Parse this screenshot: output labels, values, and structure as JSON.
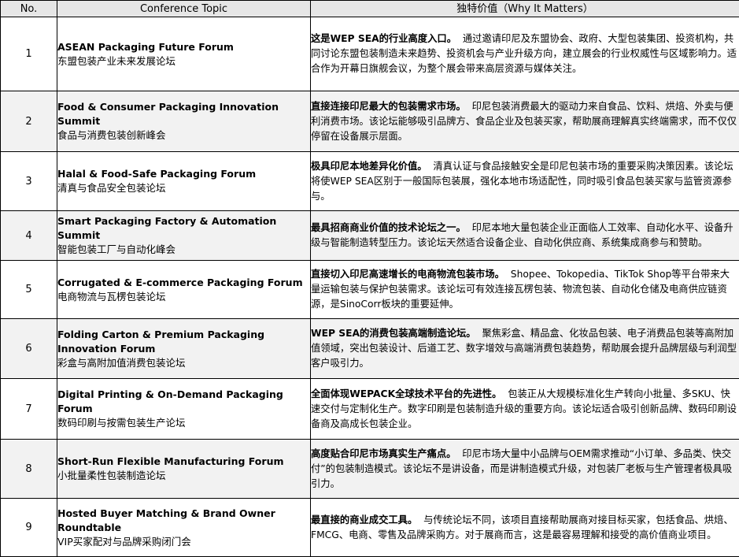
{
  "header": {
    "no": "No.",
    "topic": "Conference Topic",
    "why": "独特价值（Why It Matters）"
  },
  "rows": [
    {
      "no": "1",
      "topic_en": "ASEAN Packaging Future Forum",
      "topic_zh": "东盟包装产业未来发展论坛",
      "why_lead": "这是WEP SEA的行业高度入口。",
      "why_body": "通过邀请印尼及东盟协会、政府、大型包装集团、投资机构，共同讨论东盟包装制造未来趋势、投资机会与产业升级方向，建立展会的行业权威性与区域影响力。适合作为开幕日旗舰会议，为整个展会带来高层资源与媒体关注。"
    },
    {
      "no": "2",
      "topic_en": "Food & Consumer Packaging Innovation Summit",
      "topic_zh": "食品与消费包装创新峰会",
      "why_lead": "直接连接印尼最大的包装需求市场。",
      "why_body": "印尼包装消费最大的驱动力来自食品、饮料、烘焙、外卖与便利消费市场。该论坛能够吸引品牌方、食品企业及包装买家，帮助展商理解真实终端需求，而不仅仅停留在设备展示层面。"
    },
    {
      "no": "3",
      "topic_en": "Halal & Food-Safe Packaging Forum",
      "topic_zh": "清真与食品安全包装论坛",
      "why_lead": "极具印尼本地差异化价值。",
      "why_body": "清真认证与食品接触安全是印尼包装市场的重要采购决策因素。该论坛将使WEP SEA区别于一般国际包装展，强化本地市场适配性，同时吸引食品包装买家与监管资源参与。"
    },
    {
      "no": "4",
      "topic_en": "Smart Packaging Factory & Automation Summit",
      "topic_zh": "智能包装工厂与自动化峰会",
      "why_lead": "最具招商商业价值的技术论坛之一。",
      "why_body": "印尼本地大量包装企业正面临人工效率、自动化水平、设备升级与智能制造转型压力。该论坛天然适合设备企业、自动化供应商、系统集成商参与和赞助。"
    },
    {
      "no": "5",
      "topic_en": "Corrugated & E-commerce Packaging Forum",
      "topic_zh": "电商物流与瓦楞包装论坛",
      "why_lead": "直接切入印尼高速增长的电商物流包装市场。",
      "why_body": "Shopee、Tokopedia、TikTok Shop等平台带来大量运输包装与保护包装需求。该论坛可有效连接瓦楞包装、物流包装、自动化仓储及电商供应链资源，是SinoCorr板块的重要延伸。"
    },
    {
      "no": "6",
      "topic_en": "Folding Carton & Premium Packaging Innovation Forum",
      "topic_zh": "彩盒与高附加值消费包装论坛",
      "why_lead": "WEP SEA的消费包装高端制造论坛。",
      "why_body": "聚焦彩盒、精品盒、化妆品包装、电子消费品包装等高附加值领域，突出包装设计、后道工艺、数字增效与高端消费包装趋势，帮助展会提升品牌层级与利润型客户吸引力。"
    },
    {
      "no": "7",
      "topic_en": "Digital Printing & On-Demand Packaging Forum",
      "topic_zh": "数码印刷与按需包装生产论坛",
      "why_lead": "全面体现WEPACK全球技术平台的先进性。",
      "why_body": "包装正从大规模标准化生产转向小批量、多SKU、快速交付与定制化生产。数字印刷是包装制造升级的重要方向。该论坛适合吸引创新品牌、数码印刷设备商及高成长包装企业。"
    },
    {
      "no": "8",
      "topic_en": "Short-Run Flexible Manufacturing Forum",
      "topic_zh": "小批量柔性包装制造论坛",
      "why_lead": "高度贴合印尼市场真实生产痛点。",
      "why_body": "印尼市场大量中小品牌与OEM需求推动“小订单、多品类、快交付”的包装制造模式。该论坛不是讲设备，而是讲制造模式升级，对包装厂老板与生产管理者极具吸引力。"
    },
    {
      "no": "9",
      "topic_en": "Hosted Buyer Matching & Brand Owner Roundtable",
      "topic_zh": "VIP买家配对与品牌采购闭门会",
      "why_lead": "最直接的商业成交工具。",
      "why_body": "与传统论坛不同，该项目直接帮助展商对接目标买家，包括食品、烘焙、FMCG、电商、零售及品牌采购方。对于展商而言，这是最容易理解和接受的高价值商业项目。"
    }
  ]
}
